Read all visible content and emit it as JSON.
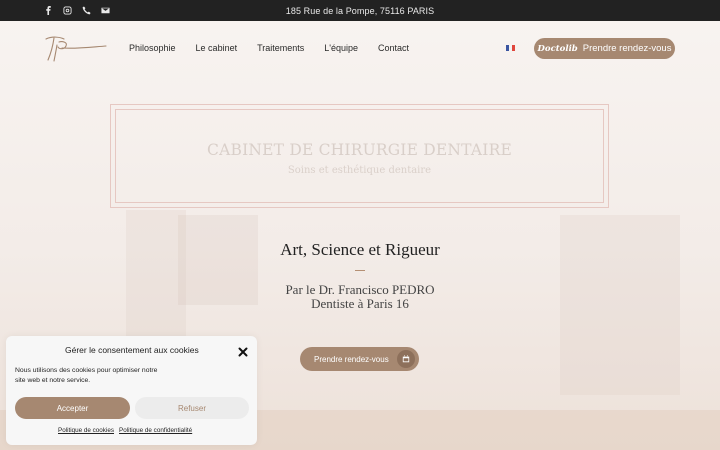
{
  "topbar": {
    "address": "185 Rue de la Pompe, 75116 PARIS",
    "social_icons": [
      "facebook-icon",
      "instagram-icon",
      "phone-icon",
      "envelope-icon"
    ]
  },
  "header": {
    "nav": [
      "Philosophie",
      "Le cabinet",
      "Traitements",
      "L'équipe",
      "Contact"
    ],
    "language_flag": "FR",
    "cta": {
      "brand": "Doctolib",
      "label": "Prendre rendez-vous"
    }
  },
  "hero": {
    "title": "CABINET DE CHIRURGIE DENTAIRE",
    "subtitle": "Soins et esthétique dentaire",
    "tagline": "Art, Science et Rigueur",
    "doctor_line1": "Par le Dr. Francisco PEDRO",
    "doctor_line2": "Dentiste à Paris 16",
    "cta_label": "Prendre rendez-vous"
  },
  "cookie": {
    "title": "Gérer le consentement aux cookies",
    "text": "Nous utilisons des cookies pour optimiser notre site web et notre service.",
    "accept": "Accepter",
    "refuse": "Refuser",
    "links": [
      "Politique de cookies",
      "Politique de confidentialité"
    ]
  },
  "colors": {
    "accent": "#a68871",
    "topbar": "#222222",
    "frame": "#e6c8c2"
  }
}
